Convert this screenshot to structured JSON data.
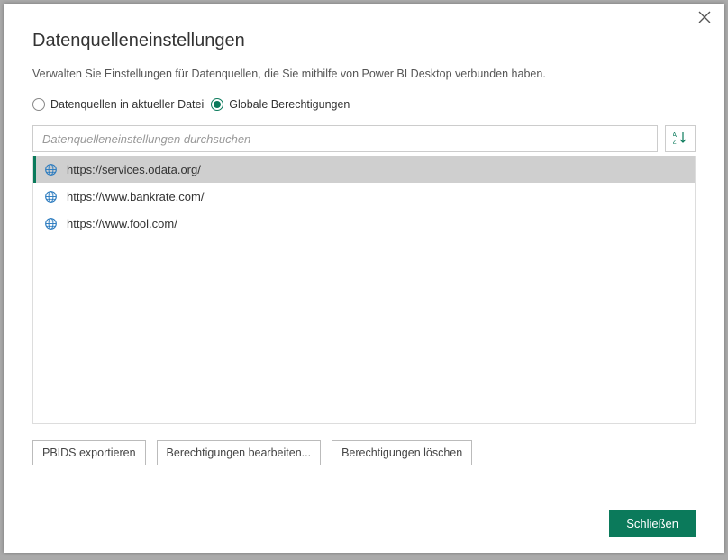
{
  "dialog": {
    "title": "Datenquelleneinstellungen",
    "subtitle": "Verwalten Sie Einstellungen für Datenquellen, die Sie mithilfe von Power BI Desktop verbunden haben."
  },
  "radios": {
    "current_file": "Datenquellen in aktueller Datei",
    "global_perms": "Globale Berechtigungen"
  },
  "search": {
    "placeholder": "Datenquelleneinstellungen durchsuchen"
  },
  "sources": [
    {
      "url": "https://services.odata.org/",
      "selected": true
    },
    {
      "url": "https://www.bankrate.com/",
      "selected": false
    },
    {
      "url": "https://www.fool.com/",
      "selected": false
    }
  ],
  "actions": {
    "export_pbids": "PBIDS exportieren",
    "edit_perms": "Berechtigungen bearbeiten...",
    "clear_perms": "Berechtigungen löschen"
  },
  "footer": {
    "close": "Schließen"
  }
}
